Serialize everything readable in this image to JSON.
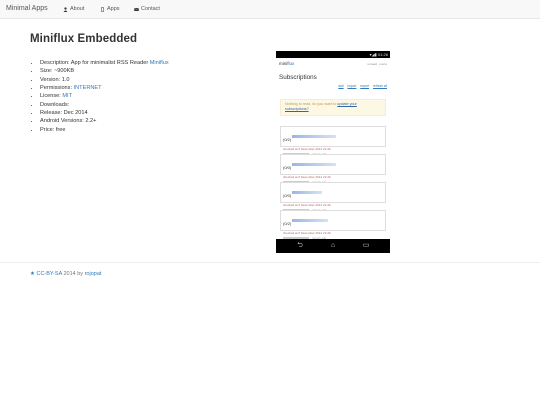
{
  "navbar": {
    "brand": "Minimal Apps",
    "links": [
      {
        "label": "About",
        "icon": "user-icon"
      },
      {
        "label": "Apps",
        "icon": "phone-icon"
      },
      {
        "label": "Contact",
        "icon": "envelope-icon"
      }
    ]
  },
  "page_title": "Miniflux Embedded",
  "details": {
    "description_prefix": "Description: App for minimalist RSS Reader ",
    "description_link": "Miniflux",
    "size": "Size: ~900KB",
    "version": "Version: 1.0",
    "permissions_prefix": "Permissions: ",
    "permissions_link": "INTERNET",
    "license_prefix": "License: ",
    "license_link": "MIT",
    "downloads": "Downloads:",
    "release": "Release: Dec 2014",
    "android": "Android Versions: 2.2+",
    "price": "Price: free"
  },
  "screenshot": {
    "status_time": "01:26",
    "app_name_mini": "mini",
    "app_name_flux": "flux",
    "menu": "unread  ·  menu",
    "heading": "Subscriptions",
    "actions": [
      "add",
      "import",
      "export",
      "refresh all"
    ],
    "alert_text": "Nothing to read, do you want to ",
    "alert_link": "update your subscriptions?",
    "items": [
      {
        "count": "(0/2)",
        "checked": "checked at 5 December 2014 22:46"
      },
      {
        "count": "(0/0)",
        "checked": "checked at 5 December 2014 22:46"
      },
      {
        "count": "(0/0)",
        "checked": "checked at 5 December 2014 22:46"
      },
      {
        "count": "(0/2)",
        "checked": "checked at 5 December 2014 22:46"
      }
    ],
    "item_actions": "refresh   edit",
    "nav_buttons": {
      "back": "⮌",
      "home": "⌂",
      "recent": "▭"
    }
  },
  "footer": {
    "license_link": "CC-BY-SA",
    "year_by": " 2014 by ",
    "author_link": "rojopat"
  }
}
